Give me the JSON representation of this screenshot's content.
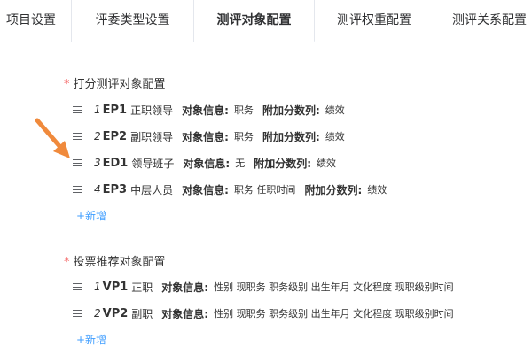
{
  "tabs": [
    "项目设置",
    "评委类型设置",
    "测评对象配置",
    "测评权重配置",
    "测评关系配置"
  ],
  "active_tab_index": 2,
  "score_section": {
    "required_mark": "*",
    "title": "打分测评对象配置",
    "items": [
      {
        "index": "1",
        "code": "EP1",
        "name": "正职领导",
        "info_label": "对象信息:",
        "info_value": "职务",
        "extra_label": "附加分数列:",
        "extra_value": "绩效"
      },
      {
        "index": "2",
        "code": "EP2",
        "name": "副职领导",
        "info_label": "对象信息:",
        "info_value": "职务",
        "extra_label": "附加分数列:",
        "extra_value": "绩效"
      },
      {
        "index": "3",
        "code": "ED1",
        "name": "领导班子",
        "info_label": "对象信息:",
        "info_value": "无",
        "extra_label": "附加分数列:",
        "extra_value": "绩效"
      },
      {
        "index": "4",
        "code": "EP3",
        "name": "中层人员",
        "info_label": "对象信息:",
        "info_value": "职务 任职时间",
        "extra_label": "附加分数列:",
        "extra_value": "绩效"
      }
    ],
    "add_label": "+新增"
  },
  "vote_section": {
    "required_mark": "*",
    "title": "投票推荐对象配置",
    "items": [
      {
        "index": "1",
        "code": "VP1",
        "name": "正职",
        "info_label": "对象信息:",
        "info_value": "性别 现职务 职务级别 出生年月 文化程度 现职级别时间"
      },
      {
        "index": "2",
        "code": "VP2",
        "name": "副职",
        "info_label": "对象信息:",
        "info_value": "性别 现职务 职务级别 出生年月 文化程度 现职级别时间"
      }
    ],
    "add_label": "+新增"
  },
  "annotation": {
    "arrow_color": "#f08a3c"
  },
  "colors": {
    "accent": "#409eff",
    "required": "#f56c6c"
  }
}
